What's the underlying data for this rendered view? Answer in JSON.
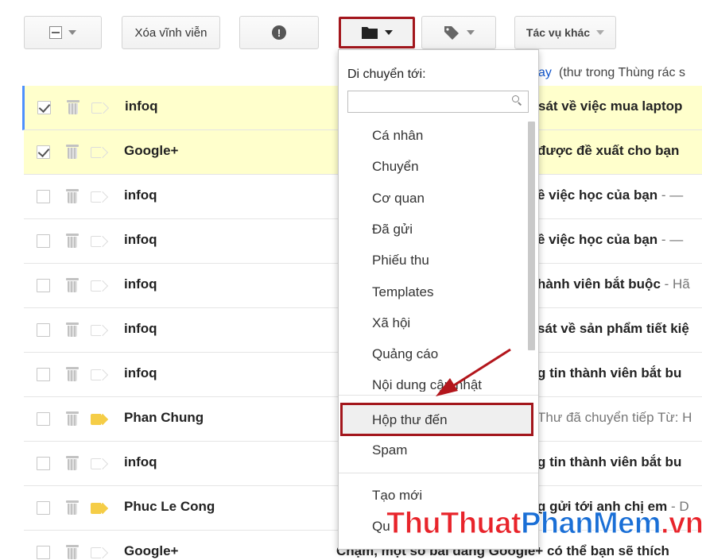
{
  "toolbar": {
    "delete_forever_label": "Xóa vĩnh viễn",
    "spam_icon_glyph": "!",
    "more_label": "Tác vụ khác",
    "icons": [
      "select-checkbox-icon",
      "report-spam-icon",
      "folder-icon",
      "label-icon",
      "chevron-down-icon"
    ]
  },
  "info_bar": {
    "link_text": "ay",
    "rest_text": "(thư trong Thùng rác s"
  },
  "emails": [
    {
      "checked": true,
      "label_color": "none",
      "sender": "infoq",
      "subject": "sát về việc mua laptop",
      "preview": ""
    },
    {
      "checked": true,
      "label_color": "none",
      "sender": "Google+",
      "subject": "được đề xuất cho bạn",
      "preview": ""
    },
    {
      "checked": false,
      "label_color": "none",
      "sender": "infoq",
      "subject": "ề việc học của bạn",
      "preview": " - —"
    },
    {
      "checked": false,
      "label_color": "none",
      "sender": "infoq",
      "subject": "ề việc học của bạn",
      "preview": " - —"
    },
    {
      "checked": false,
      "label_color": "none",
      "sender": "infoq",
      "subject": "hành viên bắt buộc",
      "preview": " - Hã"
    },
    {
      "checked": false,
      "label_color": "none",
      "sender": "infoq",
      "subject": "sát về sản phẩm tiết kiệ",
      "preview": ""
    },
    {
      "checked": false,
      "label_color": "none",
      "sender": "infoq",
      "subject": "g tin thành viên bắt bu",
      "preview": ""
    },
    {
      "checked": false,
      "label_color": "#f5cd47",
      "sender": "Phan Chung",
      "subject": "",
      "preview": "Thư đã chuyển tiếp Từ: H"
    },
    {
      "checked": false,
      "label_color": "none",
      "sender": "infoq",
      "subject": "g tin thành viên bắt bu",
      "preview": ""
    },
    {
      "checked": false,
      "label_color": "#f5cd47",
      "sender": "Phuc Le Cong",
      "subject": "g gửi tới anh chị em",
      "preview": " - D"
    },
    {
      "checked": false,
      "label_color": "none",
      "sender": "Google+",
      "subject": "Chạm, một số bài đăng Google+ có thể bạn sẽ thích",
      "preview": ""
    }
  ],
  "move_menu": {
    "title": "Di chuyển tới:",
    "search_value": "",
    "folders": [
      "Cá nhân",
      "Chuyển",
      "Cơ quan",
      "Đã gửi",
      "Phiếu thu",
      "Templates",
      "Xã hội",
      "Quảng cáo",
      "Nội dung cập nhật"
    ],
    "highlighted": "Hộp thư đến",
    "spam": "Spam",
    "create_new": "Tạo mới",
    "manage_partial": "Qu"
  },
  "watermark": {
    "part1": "ThuThuat",
    "part2": "PhanMem",
    "part3": ".vn"
  },
  "colors": {
    "highlight_border": "#a3161c",
    "selected_row": "#ffffcc",
    "link": "#1155cc",
    "label_yellow": "#f5cd47"
  }
}
